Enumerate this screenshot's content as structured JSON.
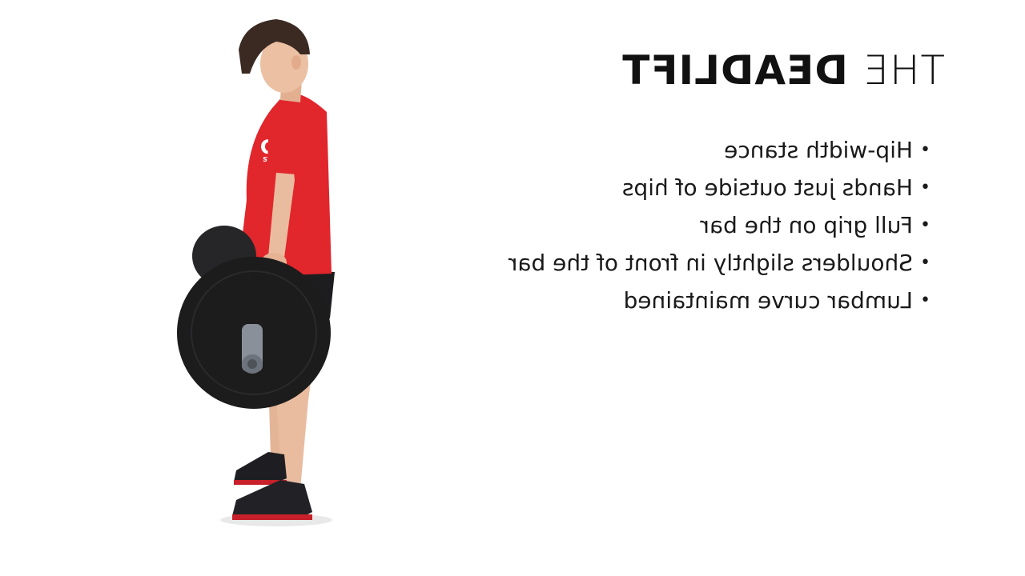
{
  "slide": {
    "title_prefix": "THE",
    "title_main": "DEADLIFT",
    "bullet_glyph": "•",
    "points": [
      "Hip-width stance",
      "Hands just outside of hips",
      "Full grip on the bar",
      "Shoulders slightly in front of the bar",
      "Lumbar curve maintained"
    ]
  },
  "shirt": {
    "logo_letters": "CF",
    "logo_word": "STAFF"
  },
  "colors": {
    "background": "#ffffff",
    "text": "#111111",
    "shirt": "#e1262c",
    "plate": "#1c1c1c",
    "bar": "#8a9099"
  }
}
